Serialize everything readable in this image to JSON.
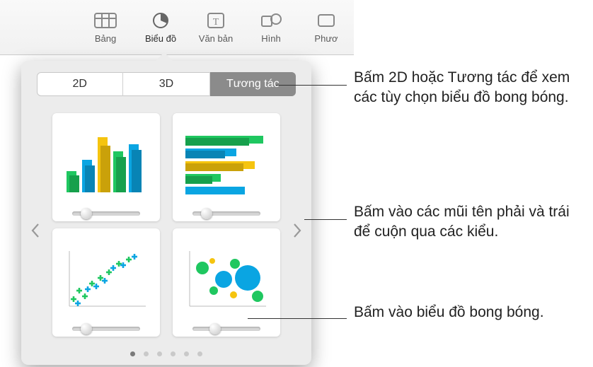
{
  "toolbar": {
    "items": [
      {
        "label": "Bảng",
        "icon": "table-icon"
      },
      {
        "label": "Biểu đồ",
        "icon": "chart-icon",
        "active": true
      },
      {
        "label": "Văn bản",
        "icon": "text-icon"
      },
      {
        "label": "Hình",
        "icon": "shape-icon"
      },
      {
        "label": "Phươ",
        "icon": "media-icon"
      }
    ]
  },
  "popover": {
    "segments": [
      "2D",
      "3D",
      "Tương tác"
    ],
    "active_segment": 2,
    "tiles": [
      {
        "name": "interactive-column-chart"
      },
      {
        "name": "interactive-bar-chart"
      },
      {
        "name": "interactive-scatter-chart"
      },
      {
        "name": "interactive-bubble-chart"
      }
    ],
    "page_count": 6,
    "page_active": 0
  },
  "callouts": {
    "c1": "Bấm 2D hoặc Tương tác để xem các tùy chọn biểu đồ bong bóng.",
    "c2": "Bấm vào các mũi tên phải và trái để cuộn qua các kiểu.",
    "c3": "Bấm vào biểu đồ bong bóng."
  },
  "chart_data": [
    {
      "type": "bar",
      "orientation": "vertical",
      "values": [
        34,
        22,
        60,
        48,
        100,
        84
      ],
      "colors": [
        "#1fc760",
        "#1fc760",
        "#0aa5e2",
        "#0aa5e2",
        "#f5c40f",
        "#f5c40f"
      ],
      "has_secondary_series": true
    },
    {
      "type": "bar",
      "orientation": "horizontal",
      "values": [
        95,
        68,
        52,
        88,
        40,
        72
      ],
      "colors": [
        "#1fc760",
        "#1fc760",
        "#0aa5e2",
        "#0aa5e2",
        "#f5c40f",
        "#f5c40f"
      ],
      "has_secondary_series": true
    },
    {
      "type": "scatter",
      "series": [
        {
          "marker": "plus",
          "color": "#1fc760"
        },
        {
          "marker": "plus",
          "color": "#0aa5e2"
        }
      ],
      "trend": "upward"
    },
    {
      "type": "bubble",
      "series": [
        {
          "color": "#1fc760"
        },
        {
          "color": "#0aa5e2"
        },
        {
          "color": "#f5c40f"
        }
      ],
      "points": [
        [
          20,
          65,
          10
        ],
        [
          30,
          45,
          6
        ],
        [
          45,
          75,
          14
        ],
        [
          55,
          40,
          8
        ],
        [
          70,
          60,
          18
        ],
        [
          85,
          30,
          9
        ],
        [
          40,
          20,
          5
        ]
      ]
    }
  ]
}
